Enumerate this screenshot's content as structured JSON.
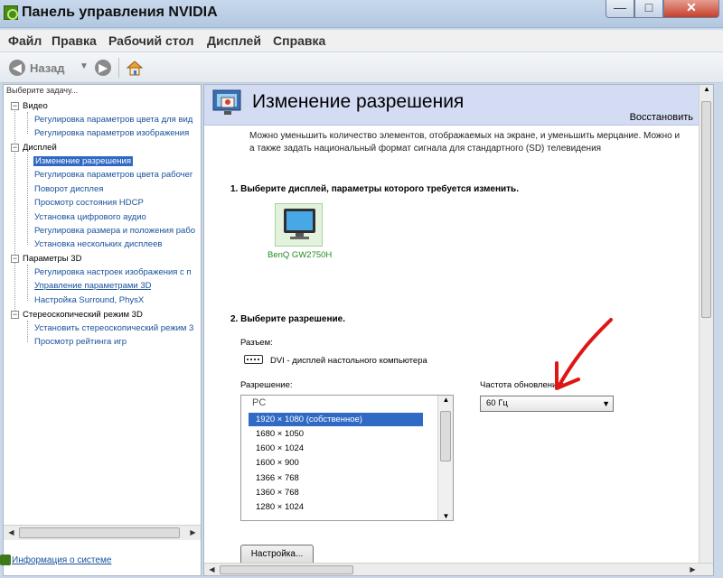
{
  "window": {
    "title": "Панель управления NVIDIA"
  },
  "menu": [
    "Файл",
    "Правка",
    "Рабочий стол",
    "Дисплей",
    "Справка"
  ],
  "toolbar": {
    "back_label": "Назад"
  },
  "left": {
    "task_header": "Выберите задачу...",
    "tree": [
      {
        "label": "Видео",
        "kind": "category"
      },
      {
        "label": "Регулировка параметров цвета для вид",
        "kind": "link"
      },
      {
        "label": "Регулировка параметров изображения ",
        "kind": "link"
      },
      {
        "label": "Дисплей",
        "kind": "category"
      },
      {
        "label": "Изменение разрешения",
        "kind": "selected"
      },
      {
        "label": "Регулировка параметров цвета рабочег",
        "kind": "link"
      },
      {
        "label": "Поворот дисплея",
        "kind": "link"
      },
      {
        "label": "Просмотр состояния HDCP",
        "kind": "link"
      },
      {
        "label": "Установка цифрового аудио",
        "kind": "link"
      },
      {
        "label": "Регулировка размера и положения рабо",
        "kind": "link"
      },
      {
        "label": "Установка нескольких дисплеев",
        "kind": "link"
      },
      {
        "label": "Параметры 3D",
        "kind": "category"
      },
      {
        "label": "Регулировка настроек изображения с п",
        "kind": "link"
      },
      {
        "label": "Управление параметрами 3D",
        "kind": "link-underline"
      },
      {
        "label": "Настройка Surround, PhysX",
        "kind": "link"
      },
      {
        "label": "Стереоскопический режим 3D",
        "kind": "category"
      },
      {
        "label": "Установить стереоскопический режим 3",
        "kind": "link"
      },
      {
        "label": "Просмотр рейтинга игр",
        "kind": "link"
      }
    ],
    "system_info": "Информация о системе"
  },
  "main": {
    "title": "Изменение разрешения",
    "restore": "Восстановить",
    "desc_line1": "Можно уменьшить количество элементов, отображаемых на экране, и уменьшить мерцание. Можно и",
    "desc_line2": "а также задать национальный формат сигнала для стандартного (SD) телевидения",
    "step1": "1. Выберите дисплей, параметры которого требуется изменить.",
    "display_name": "BenQ GW2750H",
    "step2": "2. Выберите разрешение.",
    "connection_label": "Разъем:",
    "connection_value": "DVI - дисплей настольного компьютера",
    "resolution_label": "Разрешение:",
    "resolution_group": "PC",
    "resolutions": [
      "1920 × 1080 (собственное)",
      "1680 × 1050",
      "1600 × 1024",
      "1600 × 900",
      "1366 × 768",
      "1360 × 768",
      "1280 × 1024"
    ],
    "selected_resolution": "1920 × 1080 (собственное)",
    "refresh_label": "Частота обновления:",
    "refresh_value": "60 Гц",
    "settings_button": "Настройка..."
  }
}
